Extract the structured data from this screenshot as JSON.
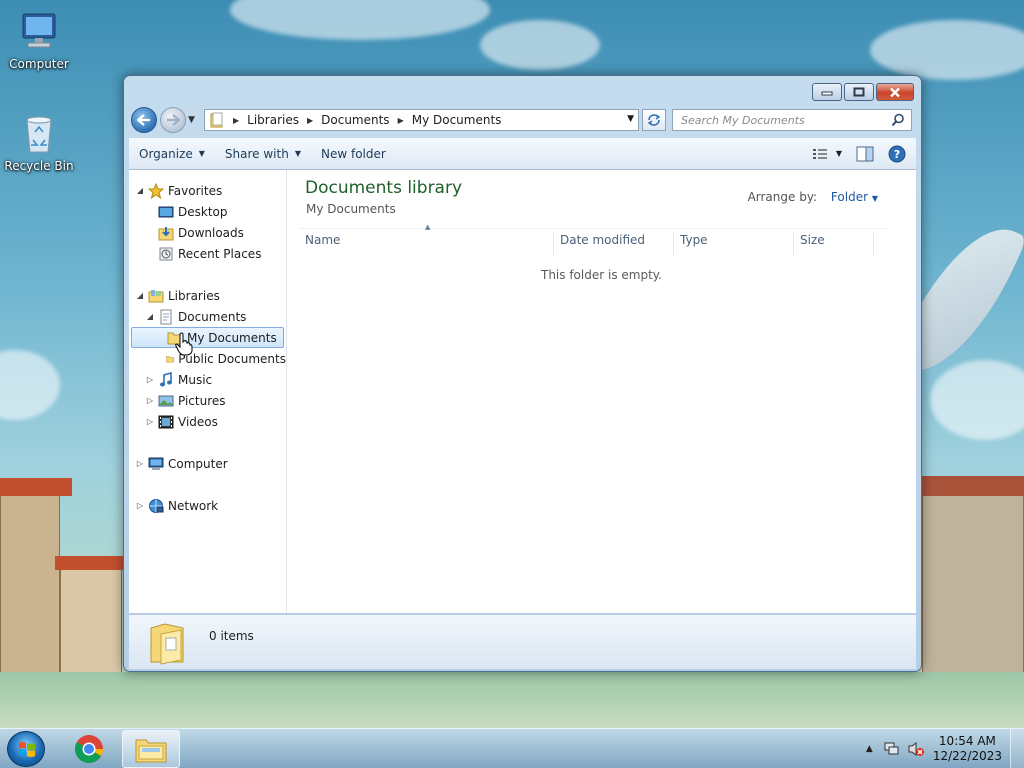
{
  "desktop": {
    "icons": [
      {
        "label": "Computer"
      },
      {
        "label": "Recycle Bin"
      }
    ]
  },
  "window": {
    "buttons": {
      "minimize": "▭",
      "maximize": "▢",
      "close": "✕"
    },
    "address": {
      "crumbs": [
        "Libraries",
        "Documents",
        "My Documents"
      ]
    },
    "search": {
      "placeholder": "Search My Documents"
    },
    "toolbar": {
      "organize": "Organize",
      "share_with": "Share with",
      "new_folder": "New folder"
    },
    "nav_pane": {
      "favorites": "Favorites",
      "desktop": "Desktop",
      "downloads": "Downloads",
      "recent_places": "Recent Places",
      "libraries": "Libraries",
      "documents": "Documents",
      "my_documents": "My Documents",
      "public_documents": "Public Documents",
      "music": "Music",
      "pictures": "Pictures",
      "videos": "Videos",
      "computer": "Computer",
      "network": "Network"
    },
    "file_pane": {
      "title": "Documents library",
      "subtitle": "My Documents",
      "arrange_label": "Arrange by:",
      "arrange_value": "Folder",
      "columns": [
        "Name",
        "Date modified",
        "Type",
        "Size"
      ],
      "empty_message": "This folder is empty."
    },
    "status": {
      "count": "0 items"
    }
  },
  "taskbar": {
    "clock_time": "10:54 AM",
    "clock_date": "12/22/2023"
  },
  "colors": {
    "library_title": "#1e5f2a",
    "accent_blue": "#2f6fb3",
    "close_red": "#c8452b"
  }
}
